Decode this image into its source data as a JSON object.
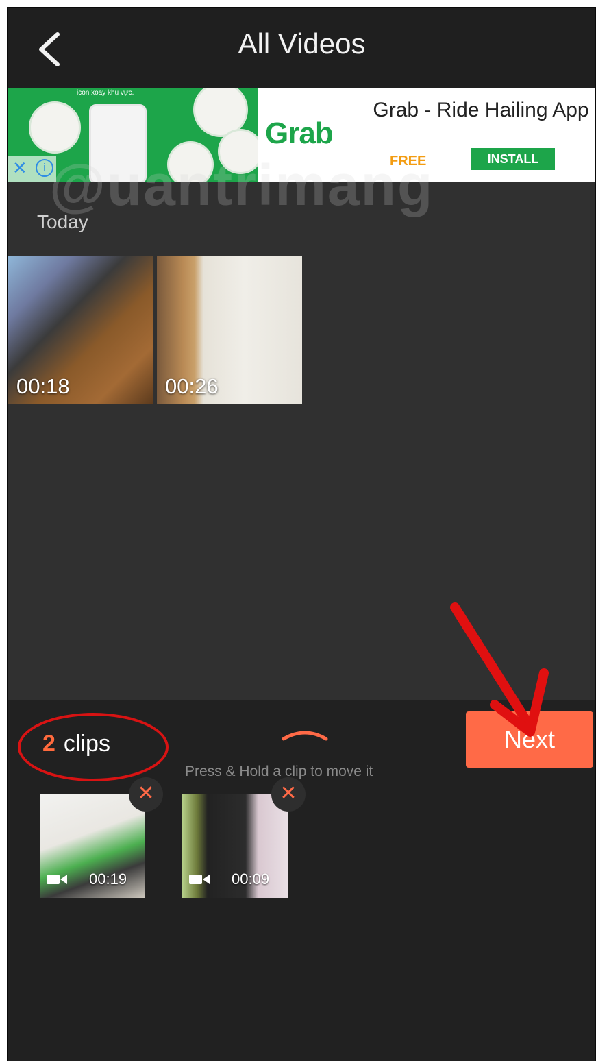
{
  "header": {
    "title": "All Videos"
  },
  "ad": {
    "caption": "icon xoay khu vực.",
    "brand_logo": "Grab",
    "app_title": "Grab - Ride Hailing App",
    "price": "FREE",
    "install_label": "INSTALL",
    "close_glyph": "✕",
    "info_glyph": "i"
  },
  "watermark": "@uantrimang",
  "library": {
    "section_label": "Today",
    "videos": [
      {
        "duration": "00:18"
      },
      {
        "duration": "00:26"
      }
    ]
  },
  "selection": {
    "count": "2",
    "count_label": "clips",
    "hint": "Press & Hold a clip to move it",
    "next_label": "Next",
    "remove_glyph": "✕",
    "clips": [
      {
        "duration": "00:19"
      },
      {
        "duration": "00:09"
      }
    ]
  },
  "colors": {
    "accent": "#ff6a47",
    "background": "#303030",
    "header": "#1f1f1f",
    "panel": "#212121",
    "annotation": "#d81313",
    "grab_green": "#1da54a"
  },
  "icons": {
    "back": "chevron-left-icon",
    "expand": "chevron-up-icon",
    "video": "video-camera-icon"
  }
}
